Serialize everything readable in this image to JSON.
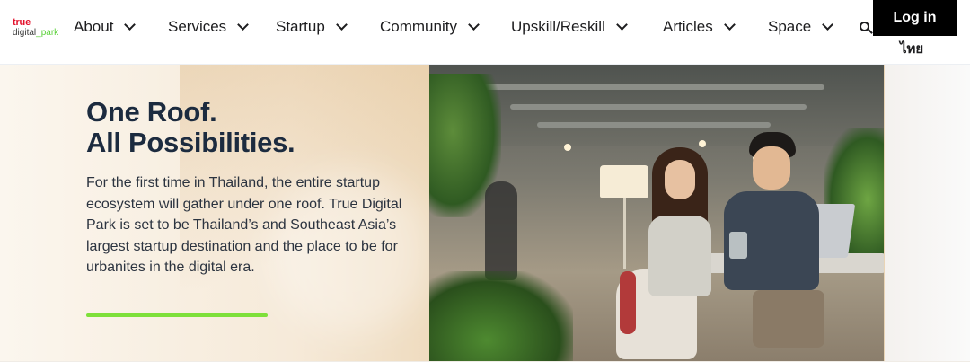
{
  "logo": {
    "line1": "true",
    "line2_a": "digital",
    "line2_sep": "_",
    "line2_b": "park"
  },
  "nav": {
    "items": [
      {
        "label": "About"
      },
      {
        "label": "Services"
      },
      {
        "label": "Startup"
      },
      {
        "label": "Community"
      },
      {
        "label": "Upskill/Reskill"
      },
      {
        "label": "Articles"
      },
      {
        "label": "Space"
      }
    ],
    "login_label": "Log in",
    "lang_label": "ไทย"
  },
  "hero": {
    "headline_line1": "One Roof.",
    "headline_line2": "All Possibilities.",
    "body": "For the first time in Thailand, the entire startup ecosystem will gather under one roof. True Digital Park is set to be Thailand’s and Southeast Asia’s largest startup destination and the place to be for urbanites in the digital era."
  },
  "colors": {
    "accent": "#7ee03a",
    "brand_red": "#e3122c",
    "headline": "#1c2b3f",
    "login_bg": "#000000"
  },
  "icons": {
    "chevron": "chevron-down-icon",
    "search": "search-icon"
  }
}
